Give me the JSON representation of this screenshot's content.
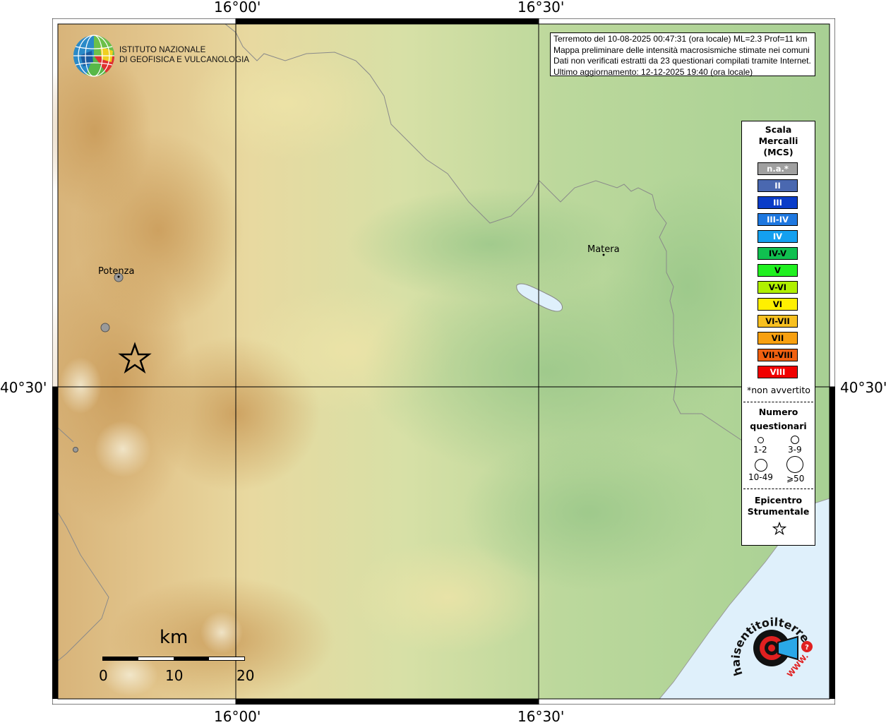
{
  "coordinates": {
    "top": [
      "16°00'",
      "16°30'"
    ],
    "bottom": [
      "16°00'",
      "16°30'"
    ],
    "left": "40°30'",
    "right": "40°30'"
  },
  "info": {
    "line1": "Terremoto del 10-08-2025 00:47:31 (ora locale) ML=2.3 Prof=11 km",
    "line2": "Mappa preliminare delle intensità macrosismiche stimate nei comuni",
    "line3": "Dati non verificati estratti da 23 questionari compilati tramite Internet.",
    "line4": "Ultimo aggiornamento: 12-12-2025 19:40 (ora locale)"
  },
  "ingv": {
    "line1": "ISTITUTO NAZIONALE",
    "line2": "DI GEOFISICA E VULCANOLOGIA"
  },
  "places": {
    "potenza": "Potenza",
    "matera": "Matera"
  },
  "legend": {
    "title": [
      "Scala",
      "Mercalli",
      "(MCS)"
    ],
    "scale": [
      {
        "label": "n.a.*",
        "color": "#a0a0a0",
        "text_color": "#ffffff"
      },
      {
        "label": "II",
        "color": "#4a68b0",
        "text_color": "#ffffff"
      },
      {
        "label": "III",
        "color": "#0a3cc8",
        "text_color": "#ffffff"
      },
      {
        "label": "III-IV",
        "color": "#1e78e0",
        "text_color": "#ffffff"
      },
      {
        "label": "IV",
        "color": "#14a0f0",
        "text_color": "#ffffff"
      },
      {
        "label": "IV-V",
        "color": "#10c050",
        "text_color": "#000000"
      },
      {
        "label": "V",
        "color": "#20f020",
        "text_color": "#000000"
      },
      {
        "label": "V-VI",
        "color": "#b0f000",
        "text_color": "#000000"
      },
      {
        "label": "VI",
        "color": "#fff000",
        "text_color": "#000000"
      },
      {
        "label": "VI-VII",
        "color": "#f8c020",
        "text_color": "#000000"
      },
      {
        "label": "VII",
        "color": "#f8a010",
        "text_color": "#000000"
      },
      {
        "label": "VII-VIII",
        "color": "#f06010",
        "text_color": "#000000"
      },
      {
        "label": "VIII",
        "color": "#f00000",
        "text_color": "#ffffff"
      }
    ],
    "not_felt": "*non avvertito",
    "count_title": [
      "Numero",
      "questionari"
    ],
    "counts": [
      "1-2",
      "3-9",
      "10-49",
      "⩾50"
    ],
    "epicenter_title": [
      "Epicentro",
      "Strumentale"
    ]
  },
  "scale_bar": {
    "unit": "km",
    "ticks": [
      "0",
      "10",
      "20"
    ]
  },
  "hsit": {
    "text": "haisentitoilterremoto.it",
    "url_text": "WWW."
  },
  "colors": {
    "grid": "#000000",
    "sea": "#dff0fb",
    "lake": "#dff0fb",
    "border": "#888888"
  },
  "markers": {
    "epicenter": "star-icon",
    "questionnaire": "circle-marker"
  }
}
